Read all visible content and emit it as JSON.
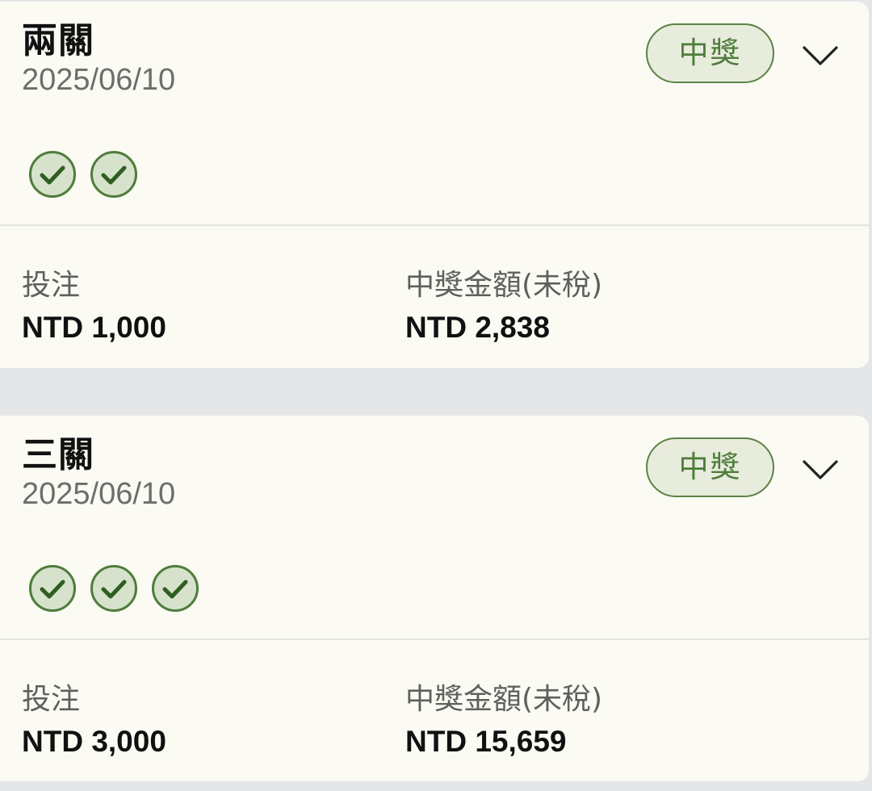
{
  "colors": {
    "page_background": "#e5e6e8",
    "card_background": "#fbfbf3",
    "accent_green": "#4f7c3b",
    "badge_background": "#e8ecdc",
    "check_fill": "#d6e2cc"
  },
  "cards": [
    {
      "title": "兩關",
      "date": "2025/06/10",
      "status_badge": "中獎",
      "expand_icon": "chevron-down-icon",
      "legs": [
        {
          "status": "won",
          "icon": "check-circle-icon"
        },
        {
          "status": "won",
          "icon": "check-circle-icon"
        }
      ],
      "stake_label": "投注",
      "stake_value": "NTD 1,000",
      "payout_label": "中獎金額(未稅)",
      "payout_value": "NTD 2,838"
    },
    {
      "title": "三關",
      "date": "2025/06/10",
      "status_badge": "中獎",
      "expand_icon": "chevron-down-icon",
      "legs": [
        {
          "status": "won",
          "icon": "check-circle-icon"
        },
        {
          "status": "won",
          "icon": "check-circle-icon"
        },
        {
          "status": "won",
          "icon": "check-circle-icon"
        }
      ],
      "stake_label": "投注",
      "stake_value": "NTD 3,000",
      "payout_label": "中獎金額(未稅)",
      "payout_value": "NTD 15,659"
    }
  ]
}
